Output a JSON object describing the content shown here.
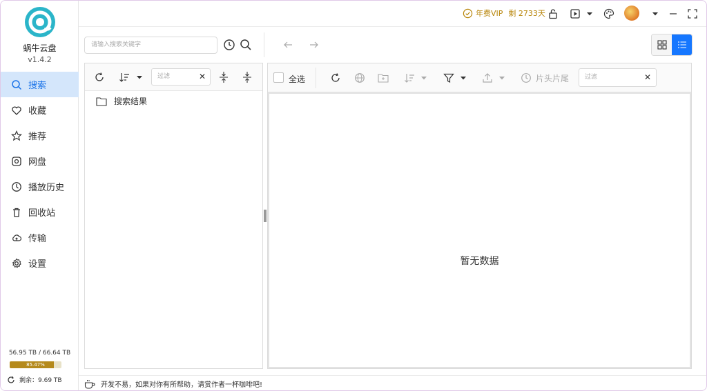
{
  "app": {
    "name": "蜗牛云盘",
    "version": "v1.4.2"
  },
  "sidebar": {
    "items": [
      {
        "label": "搜索",
        "icon": "search-icon",
        "active": true
      },
      {
        "label": "收藏",
        "icon": "heart-icon"
      },
      {
        "label": "推荐",
        "icon": "star-icon"
      },
      {
        "label": "网盘",
        "icon": "disk-icon"
      },
      {
        "label": "播放历史",
        "icon": "clock-icon"
      },
      {
        "label": "回收站",
        "icon": "trash-icon"
      },
      {
        "label": "传输",
        "icon": "cloud-icon"
      },
      {
        "label": "设置",
        "icon": "gear-icon"
      }
    ],
    "storage": {
      "usage": "56.95 TB / 66.64 TB",
      "percent": "85.47%",
      "fraction": 0.8547,
      "remaining": "剩余：9.69 TB"
    }
  },
  "titlebar": {
    "vip_label": "年费VIP",
    "vip_days": "剩 2733天",
    "vip_color": "#b8860b"
  },
  "search": {
    "placeholder": "请输入搜索关键字"
  },
  "left_panel": {
    "filter_placeholder": "过滤",
    "tree": [
      {
        "label": "搜索结果"
      }
    ]
  },
  "right_panel": {
    "select_all": "全选",
    "intro_outro": "片头片尾",
    "filter_placeholder": "过滤",
    "empty_text": "暂无数据"
  },
  "statusbar": {
    "message": "开发不易，如果对你有所帮助，请赏作者一杯咖啡吧!"
  },
  "colors": {
    "accent": "#1677ff",
    "active_nav_bg": "#d4e6fb",
    "storage_fill": "#b58a1c"
  }
}
